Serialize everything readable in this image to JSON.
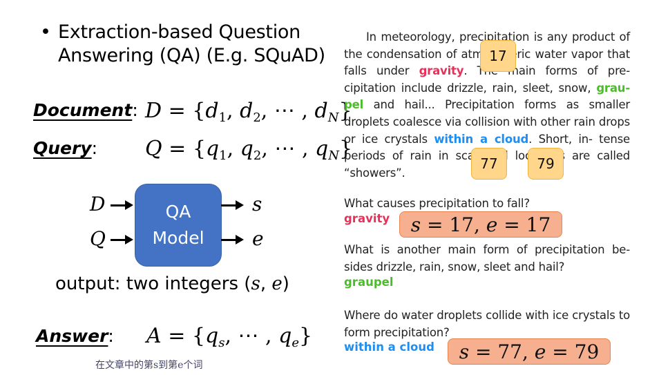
{
  "left": {
    "bullet_title_line1": "Extraction-based Question",
    "bullet_title_line2": "Answering (QA) (E.g. SQuAD)",
    "document_label": "Document",
    "document_formula": {
      "lhs": "D",
      "items": [
        "d",
        "d",
        "d"
      ],
      "subs": [
        "1",
        "2",
        "N"
      ]
    },
    "query_label": "Query",
    "query_formula": {
      "lhs": "Q",
      "items": [
        "q",
        "q",
        "q"
      ],
      "subs": [
        "1",
        "2",
        "N"
      ]
    },
    "diagram": {
      "inputs": [
        "D",
        "Q"
      ],
      "box_line1": "QA",
      "box_line2": "Model",
      "outputs": [
        "s",
        "e"
      ],
      "box_color": "#4472c4"
    },
    "output_text": "output: two integers",
    "output_vars": [
      "s",
      "e"
    ],
    "answer_label": "Answer",
    "answer_formula": {
      "lhs": "A",
      "first_sub": "s",
      "last_sub": "e"
    },
    "note_chinese": "在文章中的第s到第e个词"
  },
  "right": {
    "passage": {
      "p1": "In meteorology, precipitation is any product of the condensation of atmospheric water vapor that falls under ",
      "gravity": "gravity",
      "p2": ". The main forms of pre- cipitation include drizzle, rain, sleet, snow, ",
      "graupel": "grau- pel",
      "p3": " and hail... Precipitation forms as smaller droplets coalesce via collision with other rain drops or ice crystals ",
      "cloud": "within a cloud",
      "p4": ". Short, in- tense periods of rain in scattered locations are called “showers”."
    },
    "badges": [
      "17",
      "77",
      "79"
    ],
    "questions": [
      {
        "question": "What causes precipitation to fall?",
        "answer": "gravity",
        "span": {
          "s": "17",
          "e": "17"
        }
      },
      {
        "question": "What is another main form of precipitation be- sides drizzle, rain, snow, sleet and hail?",
        "answer": "graupel"
      },
      {
        "question": "Where do water droplets collide with ice crystals to form precipitation?",
        "answer": "within a cloud",
        "span": {
          "s": "77",
          "e": "79"
        }
      }
    ],
    "colors": {
      "gravity": "#e8315a",
      "graupel": "#4cbc2c",
      "cloud": "#1e8ef0",
      "badge": "#ffd68a",
      "span_box": "#f6b08f"
    }
  }
}
